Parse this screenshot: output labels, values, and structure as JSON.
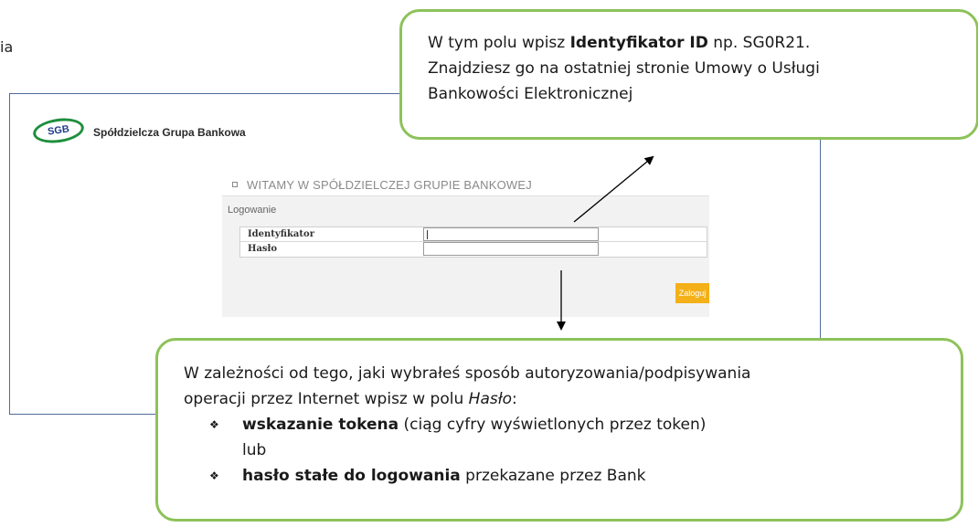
{
  "edge_text": "ia",
  "header": {
    "logo_text": "SGB",
    "bank_name": "Spółdzielcza Grupa Bankowa"
  },
  "login_panel": {
    "title": "WITAMY W SPÓŁDZIELCZEJ GRUPIE BANKOWEJ",
    "section_label": "Logowanie",
    "fields": [
      {
        "label": "Identyfikator",
        "value": ""
      },
      {
        "label": "Hasło",
        "value": ""
      }
    ],
    "login_button": "Zaloguj"
  },
  "callout_top": {
    "prefix": "W tym polu wpisz ",
    "bold": "Identyfikator ID",
    "suffix": " np. SG0R21.",
    "line2": "Znajdziesz go na ostatniej stronie Umowy o Usługi",
    "line3": "Bankowości Elektronicznej"
  },
  "callout_bottom": {
    "line1": "W zależności od tego, jaki wybrałeś sposób autoryzowania/podpisywania",
    "line2_prefix": "operacji przez Internet wpisz w polu ",
    "line2_italic": "Hasło",
    "line2_suffix": ":",
    "bullet1_bold": "wskazanie tokena",
    "bullet1_rest": " (ciąg cyfry wyświetlonych przez token)",
    "bullet1_cont": "lub",
    "bullet2_bold": "hasło stałe do logowania",
    "bullet2_rest": " przekazane przez Bank",
    "bullet_glyph": "❖"
  },
  "colors": {
    "callout_border": "#8dc25a",
    "button_bg": "#f4b018",
    "frame_border": "#4f6b9a"
  }
}
